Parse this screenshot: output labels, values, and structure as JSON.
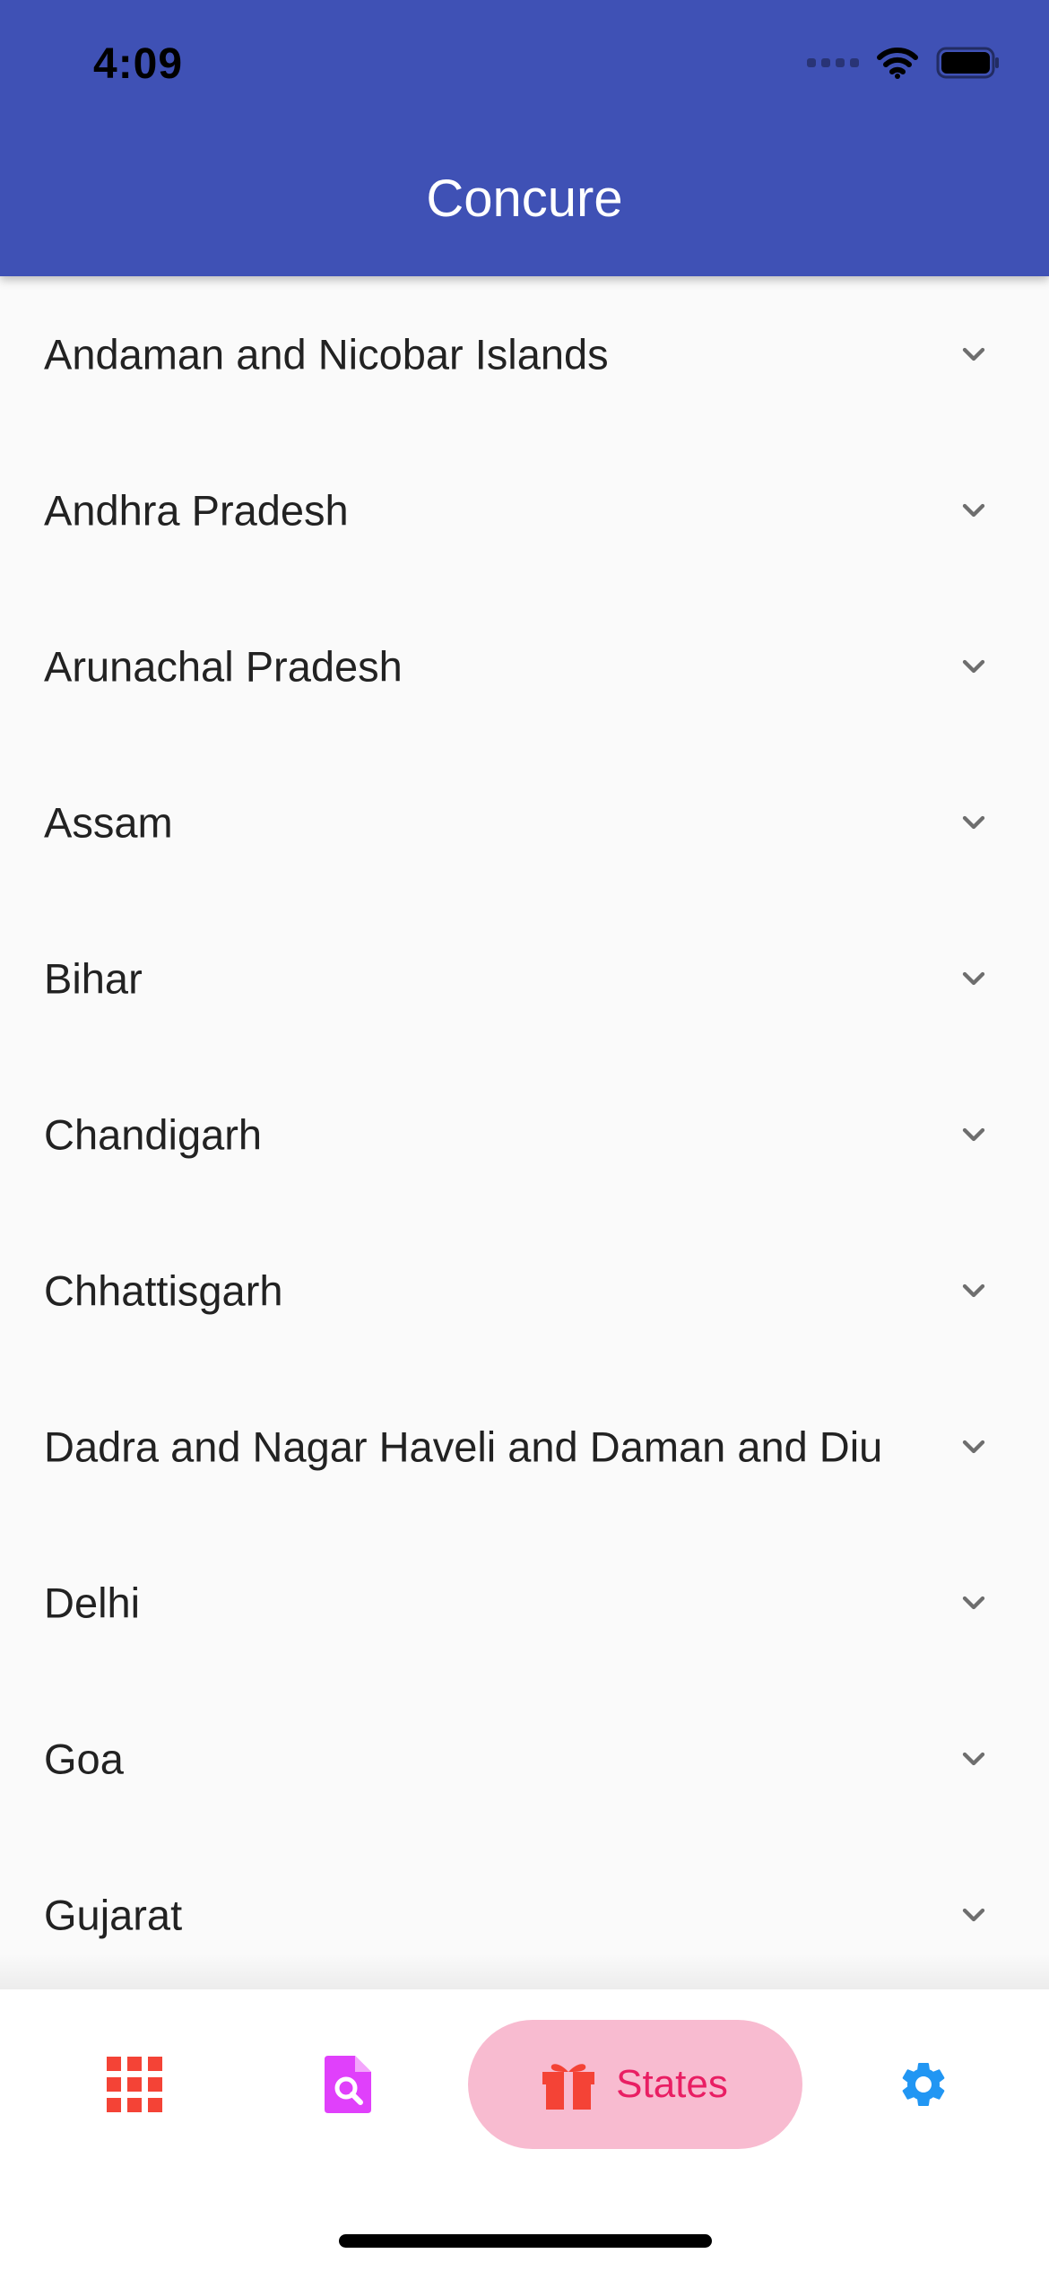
{
  "status_bar": {
    "time": "4:09",
    "wifi_icon": "wifi-icon",
    "battery_icon": "battery-icon"
  },
  "app_bar": {
    "title": "Concure",
    "color": "#3f51b5"
  },
  "states": [
    {
      "label": "Andaman and Nicobar Islands",
      "icon": "chevron-down-icon"
    },
    {
      "label": "Andhra Pradesh",
      "icon": "chevron-down-icon"
    },
    {
      "label": "Arunachal Pradesh",
      "icon": "chevron-down-icon"
    },
    {
      "label": "Assam",
      "icon": "chevron-down-icon"
    },
    {
      "label": "Bihar",
      "icon": "chevron-down-icon"
    },
    {
      "label": "Chandigarh",
      "icon": "chevron-down-icon"
    },
    {
      "label": "Chhattisgarh",
      "icon": "chevron-down-icon"
    },
    {
      "label": "Dadra and Nagar Haveli and Daman and Diu",
      "icon": "chevron-down-icon"
    },
    {
      "label": "Delhi",
      "icon": "chevron-down-icon"
    },
    {
      "label": "Goa",
      "icon": "chevron-down-icon"
    },
    {
      "label": "Gujarat",
      "icon": "chevron-down-icon"
    }
  ],
  "bottom_nav": {
    "items": [
      {
        "icon": "apps-grid-icon",
        "color": "#f44336"
      },
      {
        "icon": "document-search-icon",
        "color": "#e040fb"
      },
      {
        "icon": "gift-icon",
        "label": "States",
        "color": "#e91e63",
        "active_bg": "#f8bbd0"
      },
      {
        "icon": "settings-gear-icon",
        "color": "#2196f3"
      }
    ]
  }
}
